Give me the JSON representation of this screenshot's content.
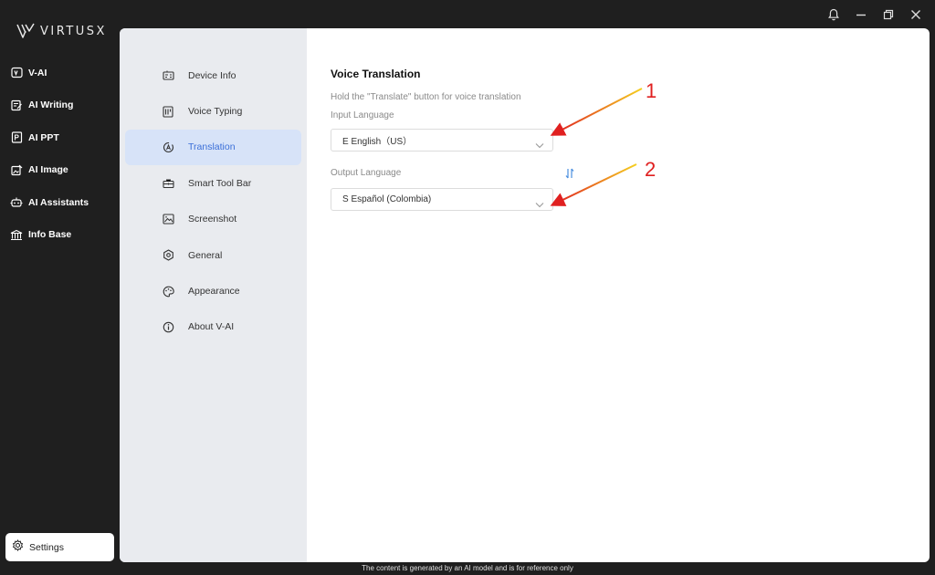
{
  "app": {
    "logo_text": "VIRTUSX"
  },
  "window_controls": [
    "bell-icon",
    "minimize-icon",
    "restore-icon",
    "close-icon"
  ],
  "nav": {
    "items": [
      {
        "label": "V-AI",
        "icon": "v-ai-icon"
      },
      {
        "label": "AI Writing",
        "icon": "edit-icon"
      },
      {
        "label": "AI PPT",
        "icon": "ppt-icon"
      },
      {
        "label": "AI Image",
        "icon": "image-icon"
      },
      {
        "label": "AI Assistants",
        "icon": "robot-icon"
      },
      {
        "label": "Info Base",
        "icon": "library-icon"
      }
    ],
    "settings_label": "Settings"
  },
  "settings_menu": {
    "items": [
      {
        "label": "Device Info",
        "icon": "device-icon"
      },
      {
        "label": "Voice Typing",
        "icon": "voice-typing-icon"
      },
      {
        "label": "Translation",
        "icon": "translate-icon",
        "active": true
      },
      {
        "label": "Smart Tool Bar",
        "icon": "toolbox-icon"
      },
      {
        "label": "Screenshot",
        "icon": "screenshot-icon"
      },
      {
        "label": "General",
        "icon": "general-icon"
      },
      {
        "label": "Appearance",
        "icon": "palette-icon"
      },
      {
        "label": "About V-AI",
        "icon": "info-icon"
      }
    ]
  },
  "translation": {
    "title": "Voice Translation",
    "hint": "Hold the \"Translate\" button for voice translation",
    "input_label": "Input Language",
    "input_value": "E English（US）",
    "output_label": "Output Language",
    "output_value": "S Español (Colombia)"
  },
  "annotations": {
    "first": "1",
    "second": "2"
  },
  "footer": "The content is generated by an AI model and is for reference only",
  "colors": {
    "accent": "#3b6fd8",
    "active_bg": "#d7e3f8",
    "annotation": "#e02020",
    "swap_icon": "#4a8fe0"
  }
}
